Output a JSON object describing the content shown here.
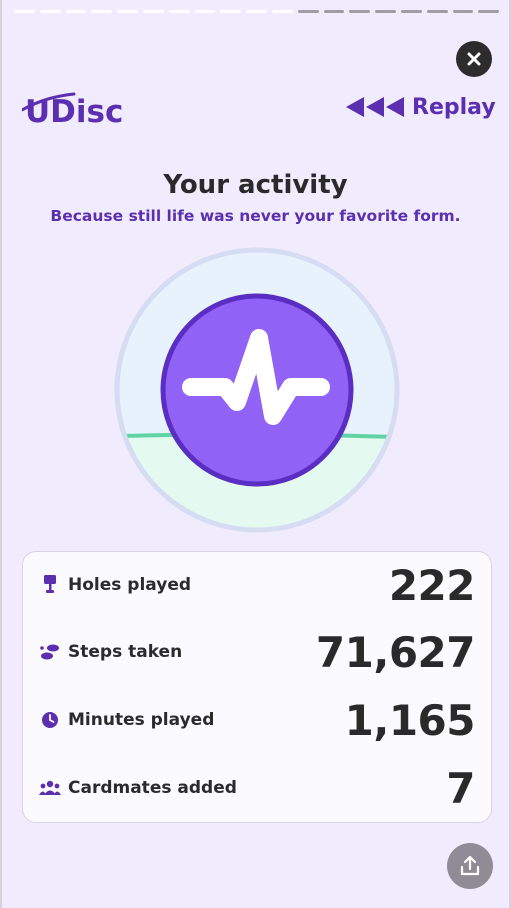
{
  "story": {
    "segments_total": 19,
    "segments_completed": 11
  },
  "header": {
    "logo_text": "UDisc",
    "replay_label": "Replay",
    "close_icon": "close-icon"
  },
  "activity": {
    "title": "Your activity",
    "subtitle": "Because still life was never your favorite form."
  },
  "stats": [
    {
      "icon": "disc-basket-icon",
      "label": "Holes played",
      "value": "222"
    },
    {
      "icon": "footsteps-icon",
      "label": "Steps taken",
      "value": "71,627"
    },
    {
      "icon": "clock-icon",
      "label": "Minutes played",
      "value": "1,165"
    },
    {
      "icon": "people-icon",
      "label": "Cardmates added",
      "value": "7"
    }
  ],
  "colors": {
    "brand_purple": "#5b2fb0",
    "badge_purple": "#8b5cf6",
    "background": "#f1ecfd",
    "ground_green": "#5fd3a4"
  },
  "share_icon": "share-icon"
}
